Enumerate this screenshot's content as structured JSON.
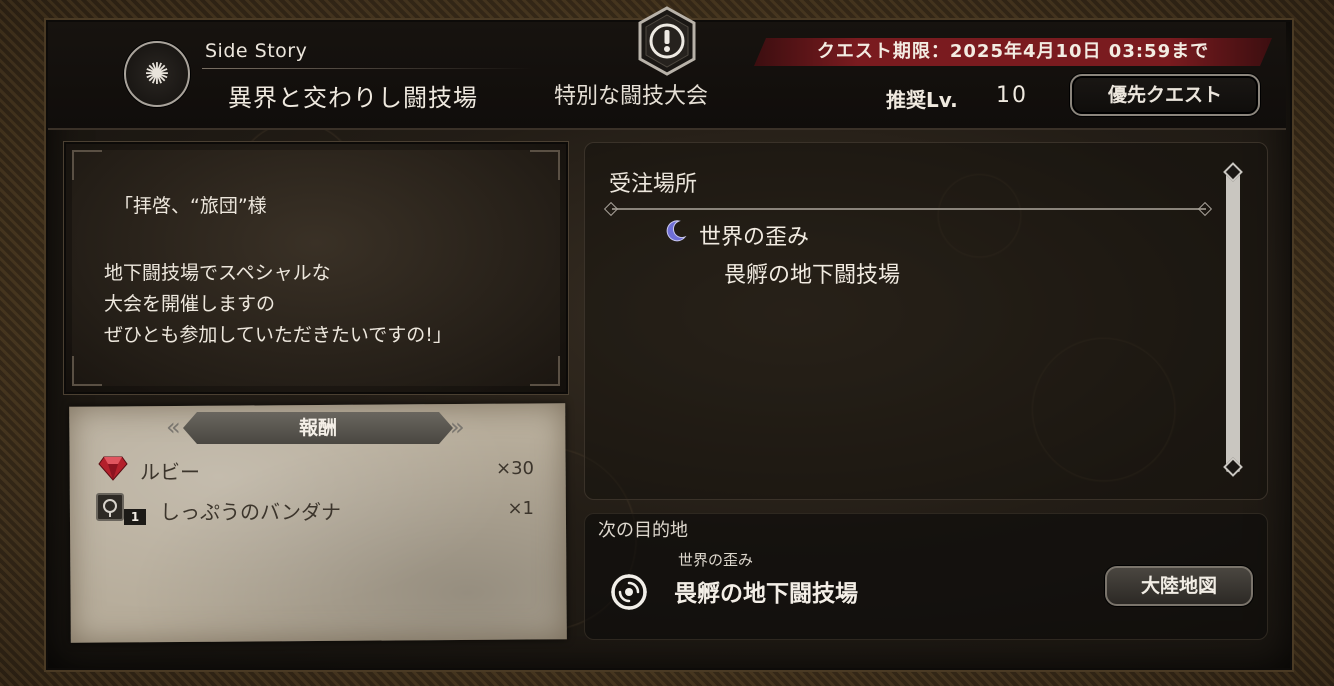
{
  "header": {
    "category": "Side Story",
    "title": "異界と交わりし闘技場",
    "subtitle": "特別な闘技大会",
    "deadline": "クエスト期限：2025年4月10日 03:59まで",
    "recommended_label": "推奨Lv.",
    "recommended_level": "10",
    "priority_button": "優先クエスト"
  },
  "message": {
    "lines": [
      "「拝啓、“旅団”様",
      "地下闘技場でスペシャルな",
      "大会を開催しますの",
      "ぜひとも参加していただきたいですの!」"
    ]
  },
  "rewards": {
    "title": "報酬",
    "items": [
      {
        "name": "ルビー",
        "qty": "×30",
        "icon": "ruby-icon"
      },
      {
        "name": "しっぷうのバンダナ",
        "qty": "×1",
        "icon": "accessory-icon",
        "badge": "1"
      }
    ]
  },
  "location": {
    "title": "受注場所",
    "region": "世界の歪み",
    "place": "畏孵の地下闘技場"
  },
  "next": {
    "label": "次の目的地",
    "region": "世界の歪み",
    "place": "畏孵の地下闘技場",
    "map_button": "大陸地図"
  },
  "colors": {
    "deadline_red": "#7a1b1f",
    "parchment": "#b7ad9b",
    "text_light": "#ede7dd",
    "moon": "#6f6fd6"
  }
}
